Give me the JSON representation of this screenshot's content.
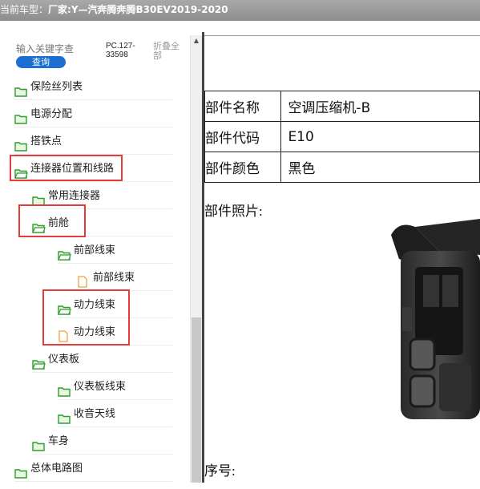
{
  "title": {
    "label": "当前车型：",
    "model": "厂家:Y—汽奔腾奔腾B30EV2019-2020"
  },
  "search": {
    "placeholder": "输入关键字查",
    "button": "查询"
  },
  "pc_code": "PC.127-33598",
  "collapse_all": "折叠全部",
  "tree": [
    {
      "label": "保险丝列表",
      "icon": "folder-icon",
      "level": 0
    },
    {
      "label": "电源分配",
      "icon": "folder-icon",
      "level": 0
    },
    {
      "label": "搭铁点",
      "icon": "folder-icon",
      "level": 0
    },
    {
      "label": "连接器位置和线路",
      "icon": "folder-open-icon",
      "level": 0
    },
    {
      "label": "常用连接器",
      "icon": "folder-icon",
      "level": 1
    },
    {
      "label": "前舱",
      "icon": "folder-open-icon",
      "level": 1
    },
    {
      "label": "前部线束",
      "icon": "folder-open-icon",
      "level": 2
    },
    {
      "label": "前部线束",
      "icon": "file-icon",
      "level": 3
    },
    {
      "label": "动力线束",
      "icon": "folder-open-icon",
      "level": 2
    },
    {
      "label": "动力线束",
      "icon": "file-icon",
      "level": 2
    },
    {
      "label": "仪表板",
      "icon": "folder-open-icon",
      "level": 1
    },
    {
      "label": "仪表板线束",
      "icon": "folder-icon",
      "level": 2
    },
    {
      "label": "收音天线",
      "icon": "folder-icon",
      "level": 2
    },
    {
      "label": "车身",
      "icon": "folder-icon",
      "level": 1
    },
    {
      "label": "总体电路图",
      "icon": "folder-icon",
      "level": 0
    }
  ],
  "detail": {
    "rows": [
      {
        "key": "部件名称",
        "value": "空调压缩机-B"
      },
      {
        "key": "部件代码",
        "value": "E10"
      },
      {
        "key": "部件颜色",
        "value": "黑色"
      }
    ],
    "photo_label": "部件照片:",
    "seq_label": "序号:"
  },
  "colors": {
    "highlight": "#e53b3b",
    "folder": "#2e9e2e",
    "file": "#f0a040",
    "button": "#1b6fd0"
  }
}
